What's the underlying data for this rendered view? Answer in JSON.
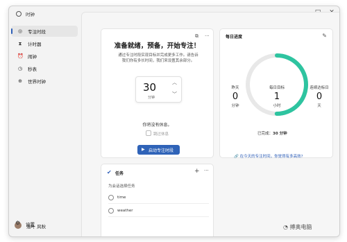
{
  "window": {
    "title": "时钟",
    "controls": {
      "minimize": "—",
      "maximize": "□",
      "close": "✕"
    }
  },
  "sidebar": {
    "items": [
      {
        "label": "专注时段",
        "icon": "focus-icon",
        "active": true
      },
      {
        "label": "计时器",
        "icon": "timer-icon",
        "active": false
      },
      {
        "label": "闹钟",
        "icon": "alarm-icon",
        "active": false
      },
      {
        "label": "秒表",
        "icon": "stopwatch-icon",
        "active": false
      },
      {
        "label": "世界时钟",
        "icon": "globe-icon",
        "active": false
      }
    ],
    "user": {
      "name": "落叶 风秋"
    },
    "settings_label": "设置"
  },
  "focus": {
    "title": "准备就绪，预备，开始专注！",
    "description": "通过专注时段实现目标并完成更多工作。请告诉我们你有多长时间，我们来设置其余部分。",
    "minutes": "30",
    "unit": "分钟",
    "break_note": "你将没有休息。",
    "skip_label": "跳过休息",
    "start_label": "启动专注时段"
  },
  "progress": {
    "title": "每日进度",
    "yesterday": {
      "label": "昨天",
      "value": "0",
      "unit": "分钟"
    },
    "goal": {
      "label": "每日目标",
      "value": "1",
      "unit": "小时"
    },
    "streak": {
      "label": "连续达标日",
      "value": "0",
      "unit": "天"
    },
    "done_label": "已完成：",
    "done_value": "30 分钟",
    "link": "在今天的专注时间，你觉得有多高效?",
    "completion": 0.5,
    "accent": "#2ec4a0"
  },
  "tasks": {
    "title": "任务",
    "subtitle": "为会话选择任务",
    "items": [
      "time",
      "weather"
    ],
    "add": "+",
    "more": "···"
  },
  "watermark": "搏奥电脑"
}
